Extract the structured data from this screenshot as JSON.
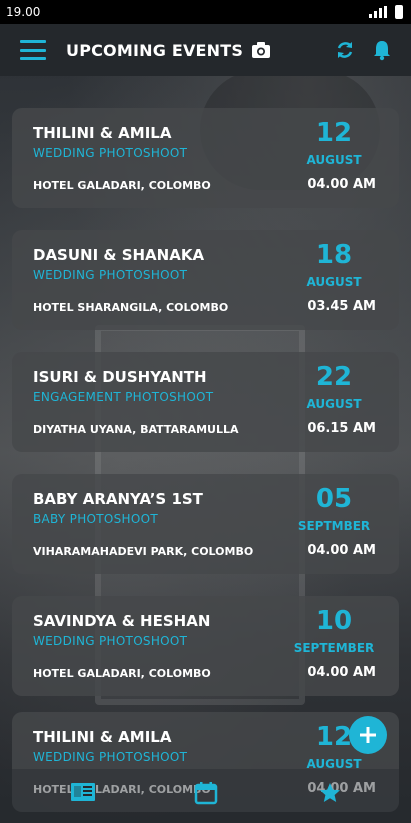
{
  "status_bar": {
    "time": "19.00"
  },
  "app_bar": {
    "title": "UPCOMING EVENTS"
  },
  "events": [
    {
      "names": "THILINI & AMILA",
      "type": "WEDDING PHOTOSHOOT",
      "venue": "HOTEL GALADARI, COLOMBO",
      "day": "12",
      "month": "AUGUST",
      "time": "04.00 AM"
    },
    {
      "names": "DASUNI & SHANAKA",
      "type": "WEDDING PHOTOSHOOT",
      "venue": "HOTEL SHARANGILA, COLOMBO",
      "day": "18",
      "month": "AUGUST",
      "time": "03.45 AM"
    },
    {
      "names": "ISURI & DUSHYANTH",
      "type": "ENGAGEMENT PHOTOSHOOT",
      "venue": "DIYATHA UYANA, BATTARAMULLA",
      "day": "22",
      "month": "AUGUST",
      "time": "06.15 AM"
    },
    {
      "names": "BABY ARANYA’S 1ST",
      "type": "BABY PHOTOSHOOT",
      "venue": "VIHARAMAHADEVI PARK, COLOMBO",
      "day": "05",
      "month": "SEPTMBER",
      "time": "04.00 AM"
    },
    {
      "names": "SAVINDYA & HESHAN",
      "type": "WEDDING PHOTOSHOOT",
      "venue": "HOTEL GALADARI, COLOMBO",
      "day": "10",
      "month": "SEPTEMBER",
      "time": "04.00 AM"
    },
    {
      "names": "THILINI & AMILA",
      "type": "WEDDING PHOTOSHOOT",
      "venue": "HOTEL GALADARI, COLOMBO",
      "day": "12",
      "month": "AUGUST",
      "time": "04.00 AM"
    }
  ],
  "icons": {
    "menu": "menu-icon",
    "camera": "camera-icon",
    "refresh": "refresh-icon",
    "bell": "bell-icon",
    "fab": "add-icon",
    "nav_events": "list-icon",
    "nav_calendar": "calendar-icon",
    "nav_favorites": "star-icon"
  },
  "colors": {
    "accent": "#1fb5d6",
    "app_bar": "#24282c",
    "card": "#46484b"
  }
}
